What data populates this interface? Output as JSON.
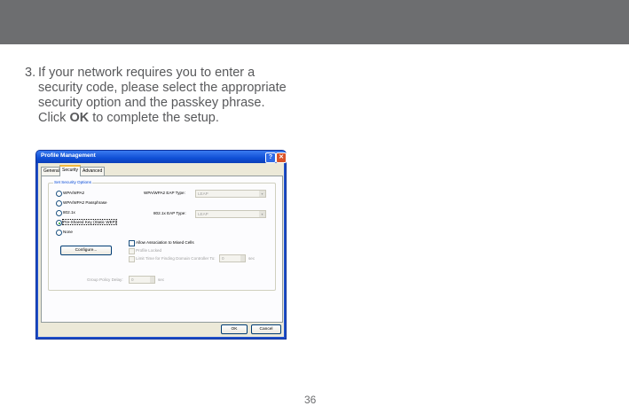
{
  "step": {
    "number": "3.",
    "line1": "If your network requires you to enter a",
    "line2": "security code, please select the appropriate",
    "line3": "security option and the passkey phrase.",
    "line4_pre": "Click ",
    "line4_bold": "OK",
    "line4_post": " to complete the setup."
  },
  "dialog": {
    "title": "Profile Management",
    "help_glyph": "?",
    "close_glyph": "✕",
    "tabs": [
      "General",
      "Security",
      "Advanced"
    ],
    "active_tab": "Security",
    "group_label": "Set Security Options",
    "radios": [
      {
        "label": "WPA/WPA2",
        "selected": false
      },
      {
        "label": "WPA/WPA2 Passphrase",
        "selected": false
      },
      {
        "label": "802.1x",
        "selected": false
      },
      {
        "label": "Pre-Shared Key (Static WEP)",
        "selected": true
      },
      {
        "label": "None",
        "selected": false
      }
    ],
    "wpa_eap_label": "WPA/WPA2 EAP Type:",
    "wpa_eap_value": "LEAP",
    "x8021_eap_label": "802.1x EAP Type:",
    "x8021_eap_value": "LEAP",
    "configure_label": "Configure...",
    "allow_assoc_label": "Allow Association to Mixed Cells",
    "profile_locked_label": "Profile Locked",
    "limit_time_label": "Limit Time for Finding Domain Controller To:",
    "limit_time_value": "0",
    "limit_time_unit": "sec",
    "group_policy_label": "Group Policy Delay:",
    "group_policy_value": "0",
    "group_policy_unit": "sec",
    "ok_label": "OK",
    "cancel_label": "Cancel"
  },
  "page_number": "36",
  "colors": {
    "topbar": "#6d6e70",
    "body_text": "#58595b",
    "titlebar": "#0f4fd6",
    "dialog_bg": "#ece9d8"
  }
}
